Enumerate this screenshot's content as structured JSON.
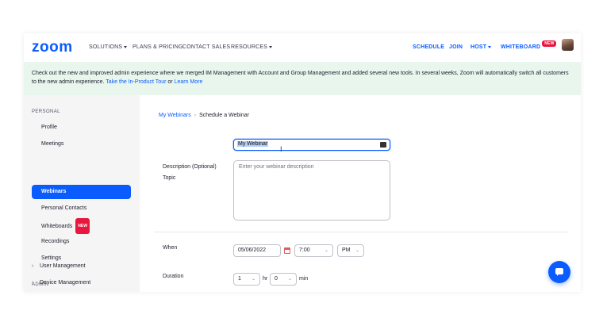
{
  "nav": {
    "logo": "zoom",
    "solutions": "SOLUTIONS",
    "plans": "PLANS & PRICING",
    "contact": "CONTACT SALES",
    "resources": "RESOURCES",
    "schedule": "SCHEDULE",
    "join": "JOIN",
    "host": "HOST",
    "whiteboard": "WHITEBOARD",
    "whiteboard_badge": "NEW"
  },
  "banner": {
    "text": "Check out the new and improved admin experience where we merged IM Management with Account and Group Management and added several new tools. In several weeks, Zoom will automatically switch all customers to the new admin experience.",
    "tour_link": "Take the In-Product Tour",
    "or": "or",
    "learn_link": "Learn More"
  },
  "sidebar": {
    "personal_heading": "PERSONAL",
    "items": [
      {
        "label": "Profile"
      },
      {
        "label": "Meetings"
      },
      {
        "label": "Webinars"
      },
      {
        "label": "Personal Contacts"
      },
      {
        "label": "Whiteboards",
        "badge": "NEW"
      },
      {
        "label": "Recordings"
      },
      {
        "label": "Settings"
      }
    ],
    "admin_heading": "ADMIN",
    "admin_items": [
      {
        "label": "User Management"
      },
      {
        "label": "Device Management"
      }
    ]
  },
  "main": {
    "breadcrumb_link": "My Webinars",
    "breadcrumb_sep": "›",
    "breadcrumb_current": "Schedule a Webinar",
    "topic_label": "Topic",
    "topic_value": "My Webinar",
    "description_label": "Description (Optional)",
    "description_placeholder": "Enter your webinar description",
    "when_label": "When",
    "date_value": "05/06/2022",
    "time_value": "7:00",
    "ampm_value": "PM",
    "duration_label": "Duration",
    "hours_value": "1",
    "hr_label": "hr",
    "minutes_value": "0",
    "min_label": "min"
  },
  "colors": {
    "brand": "#0b5cff",
    "banner_bg": "#e8f6ee",
    "badge": "#e8173d"
  }
}
